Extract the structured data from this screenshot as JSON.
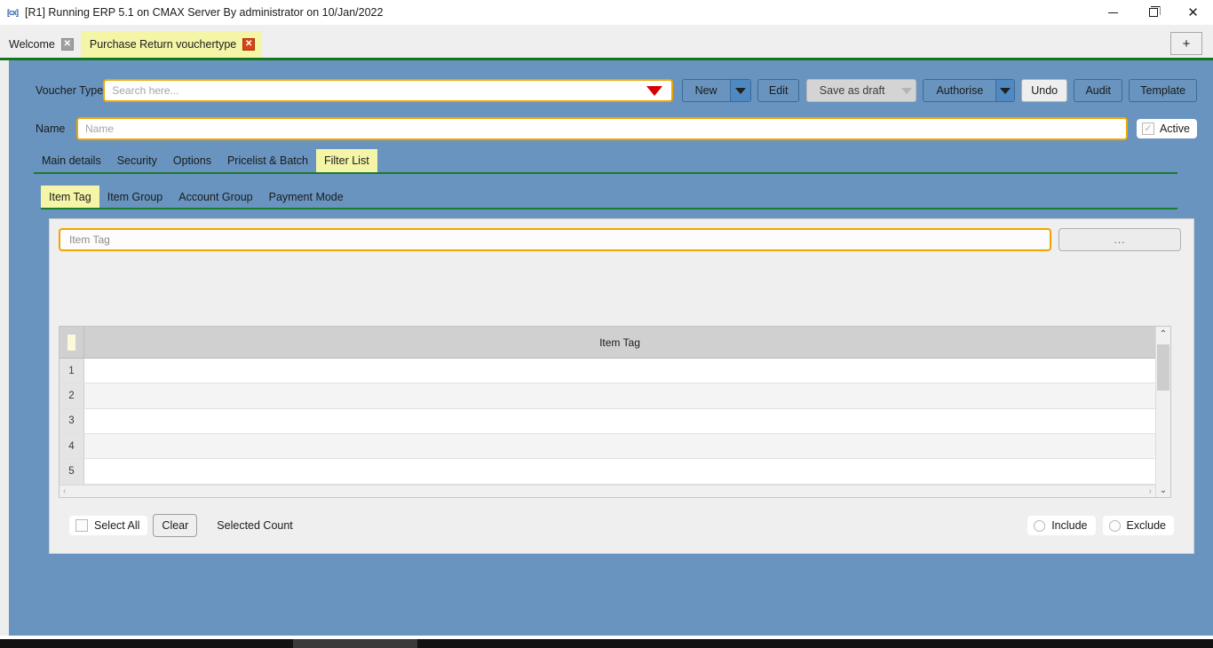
{
  "window": {
    "icon": "app-icon",
    "title": "[R1] Running ERP 5.1 on CMAX Server By administrator on 10/Jan/2022",
    "minimize_label": "–",
    "maximize_label": "❐",
    "close_label": "✕"
  },
  "mdi_tabs": {
    "items": [
      {
        "label": "Welcome",
        "close": "✕",
        "active": false
      },
      {
        "label": "Purchase Return vouchertype",
        "close": "✕",
        "active": true
      }
    ],
    "new_tab_label": "+"
  },
  "form": {
    "voucher_type_label": "Voucher Type",
    "voucher_type_placeholder": "Search here...",
    "voucher_type_value": "",
    "name_label": "Name",
    "name_placeholder": "Name",
    "name_value": "",
    "active_label": "Active",
    "active_checked": true,
    "active_mark": "✓"
  },
  "toolbar": {
    "new_label": "New",
    "edit_label": "Edit",
    "save_as_draft_label": "Save as draft",
    "authorise_label": "Authorise",
    "undo_label": "Undo",
    "audit_label": "Audit",
    "template_label": "Template"
  },
  "primary_tabs": [
    {
      "label": "Main details",
      "active": false
    },
    {
      "label": "Security",
      "active": false
    },
    {
      "label": "Options",
      "active": false
    },
    {
      "label": "Pricelist & Batch",
      "active": false
    },
    {
      "label": "Filter List",
      "active": true
    }
  ],
  "sub_tabs": [
    {
      "label": "Item Tag",
      "active": true
    },
    {
      "label": "Item Group",
      "active": false
    },
    {
      "label": "Account Group",
      "active": false
    },
    {
      "label": "Payment Mode",
      "active": false
    }
  ],
  "filter_panel": {
    "item_tag_placeholder": "Item Tag",
    "item_tag_value": "",
    "browse_label": "...",
    "grid": {
      "columns": [
        "Item Tag"
      ],
      "rows": [
        {
          "num": "1",
          "item_tag": ""
        },
        {
          "num": "2",
          "item_tag": ""
        },
        {
          "num": "3",
          "item_tag": ""
        },
        {
          "num": "4",
          "item_tag": ""
        },
        {
          "num": "5",
          "item_tag": ""
        }
      ],
      "scroll_up": "⌃",
      "scroll_down": "⌄",
      "scroll_left": "‹",
      "scroll_right": "›"
    },
    "select_all_label": "Select All",
    "select_all_checked": false,
    "clear_label": "Clear",
    "selected_count_label": "Selected Count",
    "include_label": "Include",
    "exclude_label": "Exclude",
    "include_selected": false,
    "exclude_selected": false
  },
  "colors": {
    "app_background": "#6894bf",
    "accent_tab": "#f5f5a8",
    "field_border": "#f0a500",
    "separator_green": "#1b7a2b",
    "dropdown_red": "#d60000",
    "card_background": "#efefef"
  }
}
